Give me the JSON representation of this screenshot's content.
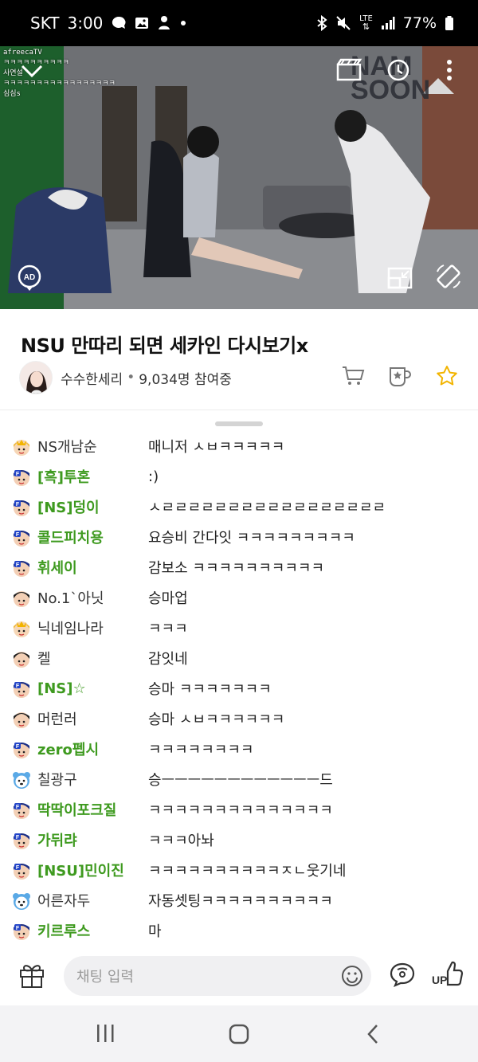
{
  "status_bar": {
    "carrier": "SKT",
    "time": "3:00",
    "battery": "77%",
    "network": "LTE",
    "icons": [
      "message-icon",
      "gallery-icon",
      "app-icon",
      "dot-icon",
      "bluetooth-icon",
      "mute-icon",
      "lte-icon",
      "signal-icon",
      "battery-icon"
    ]
  },
  "video": {
    "watermark": "NAM SOON",
    "overlay_lines": [
      "afreecaTV",
      "ㅋㅋㅋㅋㅋㅋㅋㅋㅋㅋ",
      "사연설",
      "ㅋㅋㅋㅋㅋㅋㅋㅋㅋㅋㅋㅋㅋㅋㅋㅋㅋ",
      "심심s"
    ],
    "controls": [
      "collapse-icon",
      "clip-icon",
      "history-icon",
      "more-icon",
      "ad-icon",
      "pip-icon",
      "rotate-icon"
    ]
  },
  "broadcast": {
    "title": "NSU 만따리 되면 세카인 다시보기x",
    "host": "수수한세리",
    "viewers": "9,034명 참여중"
  },
  "chat": {
    "messages": [
      {
        "nick": "NS개남순",
        "msg": "매니저 ㅅㅂㅋㅋㅋㅋㅋ",
        "badge": "manager",
        "fan": false
      },
      {
        "nick": "[흑]투혼",
        "msg": ":)",
        "badge": "fan",
        "fan": true
      },
      {
        "nick": "[NS]덩이",
        "msg": "ㅅㄹㄹㄹㄹㄹㄹㄹㄹㄹㄹㄹㄹㄹㄹㄹㄹㄹ",
        "badge": "fan",
        "fan": true
      },
      {
        "nick": "콜드피치용",
        "msg": "요승비 간다잇 ㅋㅋㅋㅋㅋㅋㅋㅋㅋ",
        "badge": "fan",
        "fan": true
      },
      {
        "nick": "휘세이",
        "msg": "감보소 ㅋㅋㅋㅋㅋㅋㅋㅋㅋㅋ",
        "badge": "fan",
        "fan": true
      },
      {
        "nick": "No.1`아닛",
        "msg": "승마업",
        "badge": "user",
        "fan": false
      },
      {
        "nick": "닉네임나라",
        "msg": "ㅋㅋㅋ",
        "badge": "manager",
        "fan": false
      },
      {
        "nick": "켈",
        "msg": "감잇네",
        "badge": "user",
        "fan": false
      },
      {
        "nick": "[NS]☆",
        "msg": "승마 ㅋㅋㅋㅋㅋㅋㅋ",
        "badge": "fan",
        "fan": true
      },
      {
        "nick": "머런러",
        "msg": "승마 ㅅㅂㅋㅋㅋㅋㅋㅋ",
        "badge": "user",
        "fan": false
      },
      {
        "nick": "zero펩시",
        "msg": "ㅋㅋㅋㅋㅋㅋㅋㅋ",
        "badge": "fan",
        "fan": true
      },
      {
        "nick": "칠광구",
        "msg": "승ㅡㅡㅡㅡㅡㅡㅡㅡㅡㅡㅡㅡ드",
        "badge": "bear",
        "fan": false
      },
      {
        "nick": "딱딱이포크질",
        "msg": "ㅋㅋㅋㅋㅋㅋㅋㅋㅋㅋㅋㅋㅋㅋ",
        "badge": "fan",
        "fan": true
      },
      {
        "nick": "가뒤랴",
        "msg": "ㅋㅋㅋ아놔",
        "badge": "fan",
        "fan": true
      },
      {
        "nick": "[NSU]민이진",
        "msg": "ㅋㅋㅋㅋㅋㅋㅋㅋㅋㅋㅈㄴ웃기네",
        "badge": "fan",
        "fan": true
      },
      {
        "nick": "어른자두",
        "msg": "자동셋팅ㅋㅋㅋㅋㅋㅋㅋㅋㅋㅋ",
        "badge": "bear",
        "fan": false
      },
      {
        "nick": "키르루스",
        "msg": "마",
        "badge": "fan",
        "fan": true
      }
    ]
  },
  "input": {
    "placeholder": "채팅 입력",
    "up_label": "UP"
  },
  "colors": {
    "fan_nick": "#3e9a1f",
    "accent": "#2f6ee0"
  }
}
